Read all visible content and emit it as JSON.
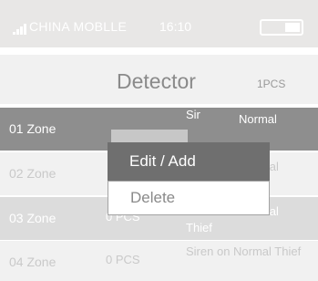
{
  "status_bar": {
    "carrier": "CHINA MOBLLE",
    "time": "16:10",
    "icons": [
      "signal-icon",
      "battery-icon"
    ]
  },
  "header": {
    "title": "Detector",
    "count": "1PCS"
  },
  "rows": [
    {
      "zone": "01 Zone",
      "pcs": "",
      "type": "Sir",
      "status": "Normal"
    },
    {
      "zone": "02 Zone",
      "pcs": "",
      "type": "",
      "status": "Normal"
    },
    {
      "zone": "03 Zone",
      "pcs": "0 PCS",
      "type": "Thief",
      "status": "Normal"
    },
    {
      "zone": "04 Zone",
      "pcs": "0 PCS",
      "type": "Siren on Normal Thief",
      "status": ""
    }
  ],
  "context_menu": {
    "edit_label": "Edit / Add",
    "delete_label": "Delete"
  },
  "colors": {
    "status_bar": "#e8e7e6",
    "selected_row": "#8e8e8e",
    "menu_highlight": "#6f6f6f"
  }
}
